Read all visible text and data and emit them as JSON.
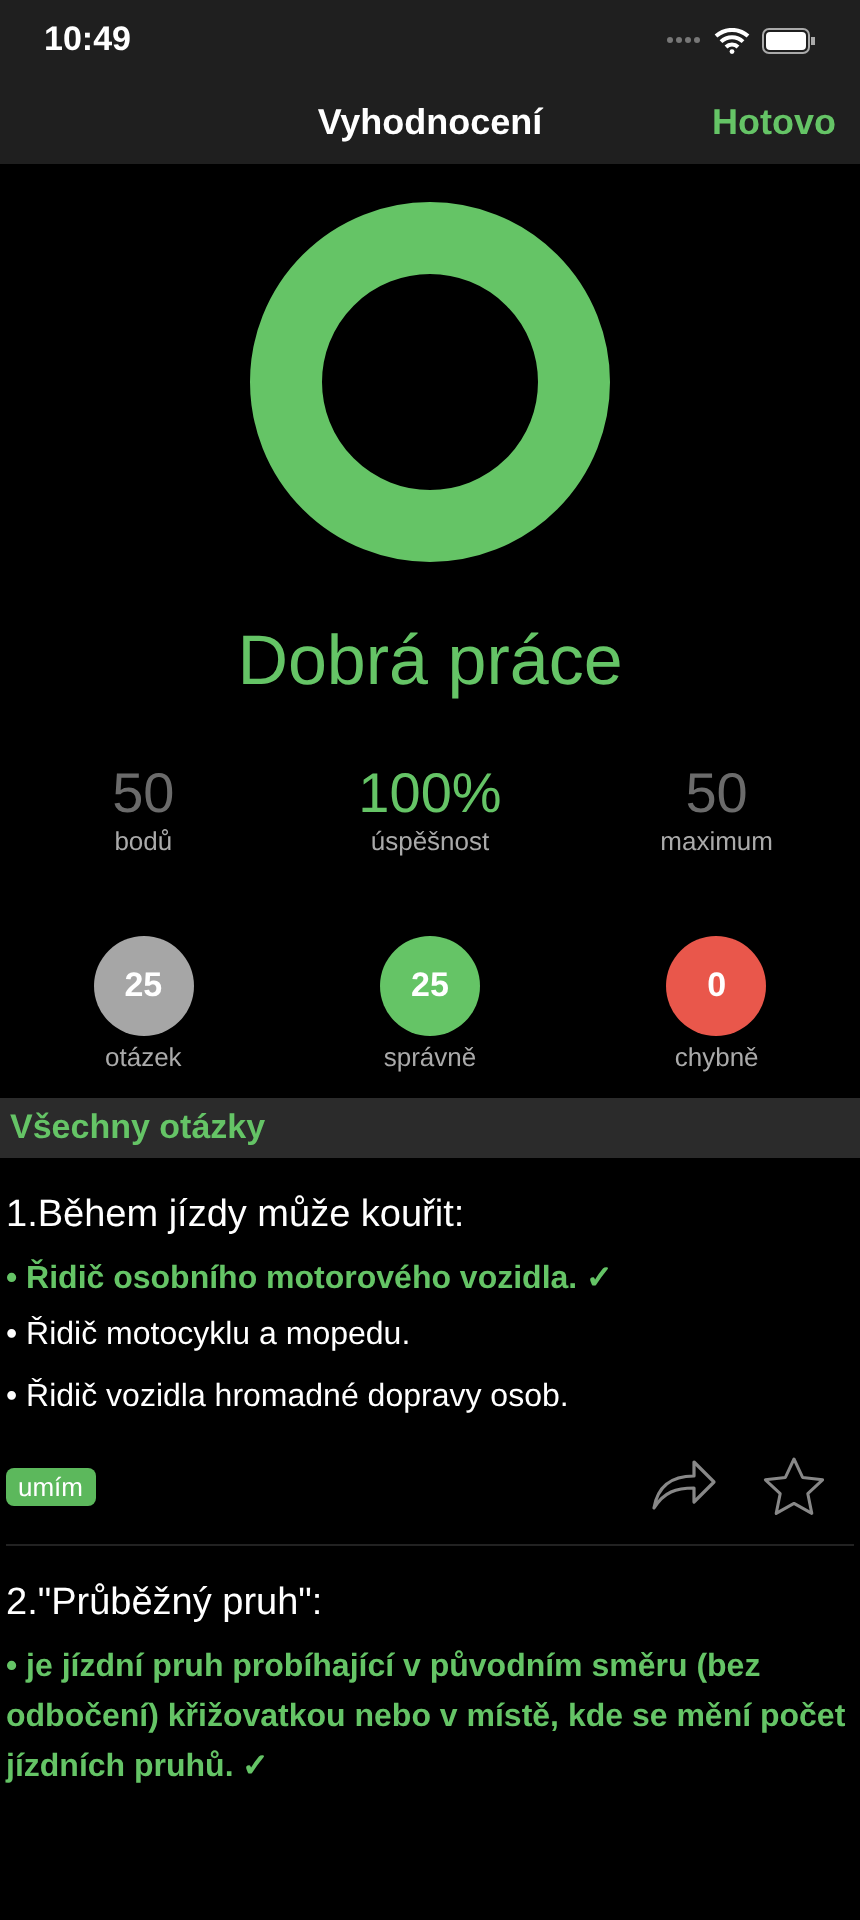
{
  "status_bar": {
    "time": "10:49"
  },
  "nav": {
    "title": "Vyhodnocení",
    "done": "Hotovo"
  },
  "result": {
    "headline": "Dobrá práce"
  },
  "stats": [
    {
      "value": "50",
      "label": "bodů",
      "color": "#6b6b6b"
    },
    {
      "value": "100%",
      "label": "úspěšnost",
      "color": "#65c466"
    },
    {
      "value": "50",
      "label": "maximum",
      "color": "#6b6b6b"
    }
  ],
  "counts": [
    {
      "value": "25",
      "label": "otázek",
      "color": "#a6a6a6"
    },
    {
      "value": "25",
      "label": "správně",
      "color": "#65c466"
    },
    {
      "value": "0",
      "label": "chybně",
      "color": "#e9574b"
    }
  ],
  "section": {
    "title": "Všechny otázky"
  },
  "questions": [
    {
      "title": "1.Během jízdy může kouřit:",
      "answers": [
        {
          "text": "• Řidič osobního motorového vozidla. ✓",
          "correct": true
        },
        {
          "text": "• Řidič motocyklu a mopedu.",
          "correct": false
        },
        {
          "text": "• Řidič vozidla hromadné dopravy osob.",
          "correct": false
        }
      ],
      "tag": "umím"
    },
    {
      "title": "2.\"Průběžný pruh\":",
      "answers": [
        {
          "text": "• je jízdní pruh probíhající v původním směru (bez odbočení) křižovatkou nebo v místě, kde se mění počet jízdních pruhů. ✓",
          "correct": true
        }
      ]
    }
  ]
}
